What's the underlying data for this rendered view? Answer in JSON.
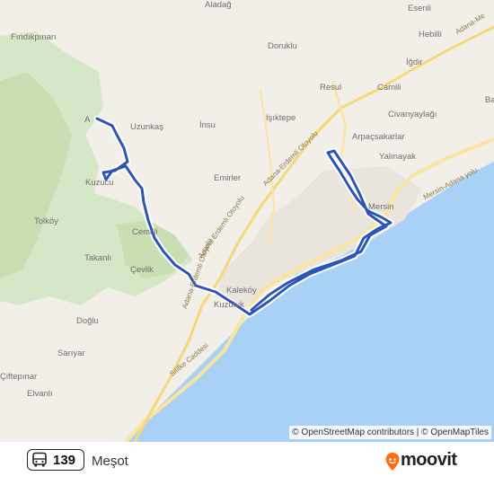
{
  "map": {
    "places": {
      "aladag": "Aladağ",
      "esenli": "Esenli",
      "hebilli": "Hebilli",
      "findikpinari": "Fındıkpınarı",
      "dorukl": "Doruklu",
      "igdir": "İğdir",
      "resul": "Resul",
      "camili": "Camili",
      "civanyaylagi": "Civanyaylağı",
      "uzunkas": "Uzunkaş",
      "insu": "İnsu",
      "isiktepe": "Işıktepe",
      "arpacsakarlar": "Arpaçsakarlar",
      "yalinayak": "Yalınayak",
      "emirler": "Emirler",
      "kuzucu": "Kuzucu",
      "tolkoy": "Tolköy",
      "ceri": "Cemilli",
      "cevlik": "Çevlik",
      "takanli": "Takanlı",
      "kalekoy": "Kaleköy",
      "kuzuluk": "Kuzuluk",
      "dogu": "Doğlu",
      "sariyar": "Sarıyar",
      "ciftepinar": "Çiftepınar",
      "elvanli": "Elvanlı",
      "mersin": "Mersin",
      "edge_a": "A",
      "edge_ba": "Ba"
    },
    "roads": {
      "adana_erdemli_1": "Adana-Erdemli Otoyolu",
      "adana_erdemli_2": "Adana-Erdemli Otoyolu",
      "adana_erdemli_3": "Adana-Erdemli Otoyolu",
      "silifke": "Silifke Caddesi",
      "mersin_adana": "Mersin-Adana yolu",
      "adana_ne": "Adana-Me"
    },
    "colors": {
      "land": "#f2efe9",
      "forest": "#cfe3bf",
      "sea": "#a9cdf2",
      "road": "#fbe6a4",
      "route": "#2c56b4"
    },
    "attribution": "© OpenStreetMap contributors | © OpenMapTiles"
  },
  "footer": {
    "route_number": "139",
    "destination": "Meşot",
    "brand": "moovit",
    "bus_icon": "bus-icon",
    "brand_icon": "moovit-pin-icon"
  }
}
